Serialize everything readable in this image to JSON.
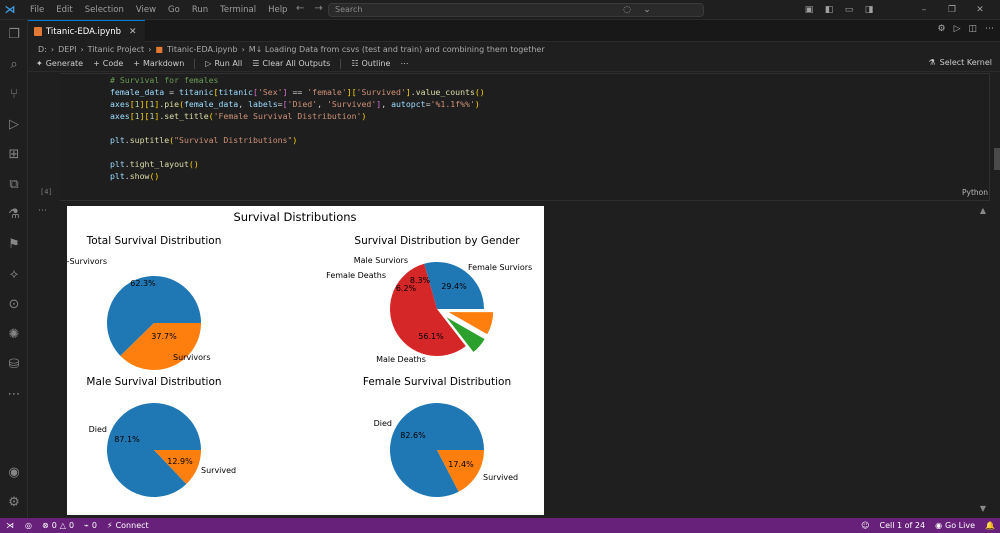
{
  "menu": [
    "File",
    "Edit",
    "Selection",
    "View",
    "Go",
    "Run",
    "Terminal",
    "Help"
  ],
  "search": {
    "placeholder": "Search"
  },
  "tab": {
    "label": "Titanic-EDA.ipynb"
  },
  "breadcrumb": [
    "D:",
    "DEPI",
    "Titanic Project",
    "Titanic-EDA.ipynb",
    "M↓ Loading Data from csvs (test and train) and combining them together"
  ],
  "toolbar": {
    "generate": "Generate",
    "code": "Code",
    "markdown": "Markdown",
    "run_all": "Run All",
    "clear_outputs": "Clear All Outputs",
    "outline": "Outline",
    "select_kernel": "Select Kernel"
  },
  "cell": {
    "exec_count": "[4]",
    "language": "Python",
    "lines": [
      "# Survival for females",
      "female_data = titanic[titanic['Sex'] == 'female']['Survived'].value_counts()",
      "axes[1][1].pie(female_data, labels=['Died', 'Survived'], autopct='%1.1f%%')",
      "axes[1][1].set_title('Female Survival Distribution')",
      "",
      "plt.suptitle(\"Survival Distributions\")",
      "",
      "plt.tight_layout()",
      "plt.show()"
    ]
  },
  "chart_data": {
    "type": "pie",
    "suptitle": "Survival Distributions",
    "colors": {
      "blue": "#1f77b4",
      "orange": "#ff7f0e",
      "green": "#2ca02c",
      "red": "#d62728"
    },
    "charts": [
      {
        "title": "Total Survival Distribution",
        "slices": [
          {
            "label": "Non-Survivors",
            "value": 62.3,
            "pct": "62.3%"
          },
          {
            "label": "Survivors",
            "value": 37.7,
            "pct": "37.7%"
          }
        ]
      },
      {
        "title": "Survival Distribution by Gender",
        "slices": [
          {
            "label": "Female Surviors",
            "value": 29.4,
            "pct": "29.4%"
          },
          {
            "label": "Male Deaths",
            "value": 56.1,
            "pct": "56.1%"
          },
          {
            "label": "Female Deaths",
            "value": 6.2,
            "pct": "6.2%"
          },
          {
            "label": "Male Surviors",
            "value": 8.3,
            "pct": "8.3%"
          }
        ]
      },
      {
        "title": "Male Survival Distribution",
        "slices": [
          {
            "label": "Died",
            "value": 87.1,
            "pct": "87.1%"
          },
          {
            "label": "Survived",
            "value": 12.9,
            "pct": "12.9%"
          }
        ]
      },
      {
        "title": "Female Survival Distribution",
        "slices": [
          {
            "label": "Died",
            "value": 82.6,
            "pct": "82.6%"
          },
          {
            "label": "Survived",
            "value": 17.4,
            "pct": "17.4%"
          }
        ]
      }
    ]
  },
  "status": {
    "errors": "0",
    "warnings": "0",
    "ports": "0",
    "connect": "Connect",
    "cell_pos": "Cell 1 of 24",
    "go_live": "Go Live"
  }
}
